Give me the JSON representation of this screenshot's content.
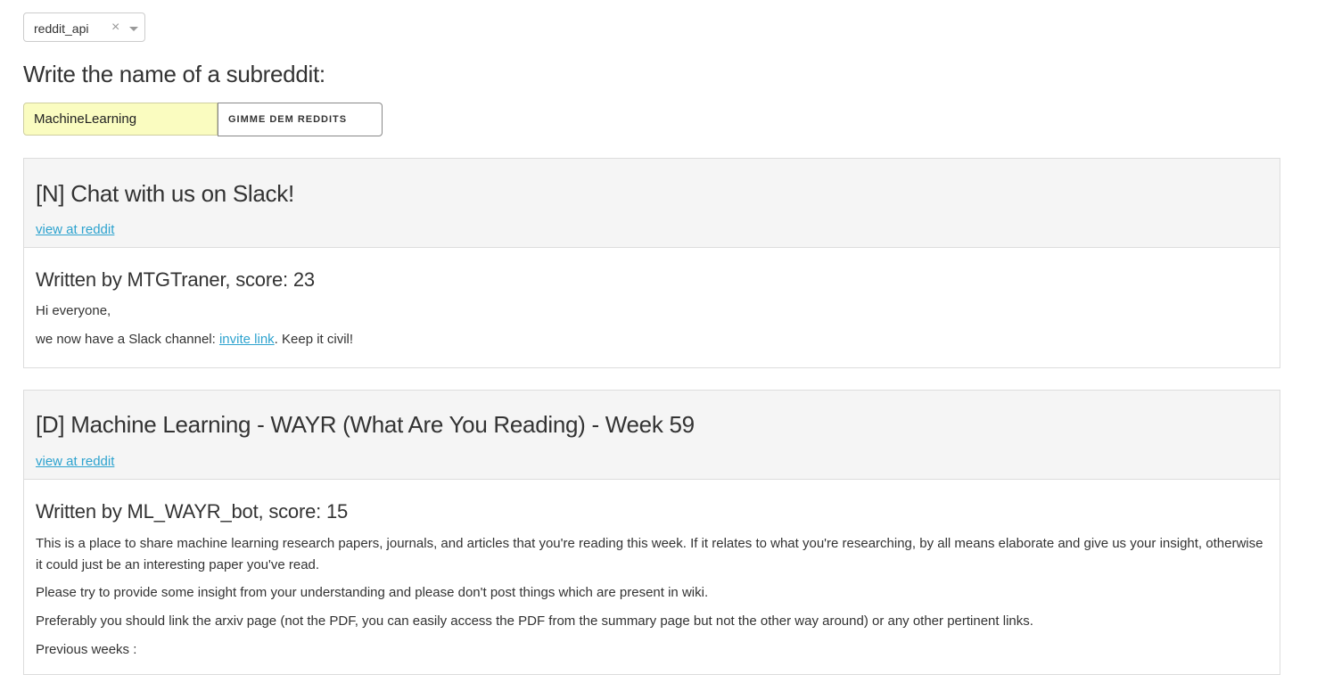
{
  "selector": {
    "value": "reddit_api",
    "clear_glyph": "×"
  },
  "prompt": "Write the name of a subreddit:",
  "search": {
    "value": "MachineLearning",
    "button_label": "GIMME DEM REDDITS"
  },
  "posts": [
    {
      "title": "[N] Chat with us on Slack!",
      "link_label": "view at reddit",
      "author_line": "Written by MTGTraner, score: 23",
      "paragraphs": [
        "Hi everyone,"
      ],
      "p2_before": "we now have a Slack channel: ",
      "p2_link": "invite link",
      "p2_after": ". Keep it civil!"
    },
    {
      "title": "[D] Machine Learning - WAYR (What Are You Reading) - Week 59",
      "link_label": "view at reddit",
      "author_line": "Written by ML_WAYR_bot, score: 15",
      "paragraphs": [
        "This is a place to share machine learning research papers, journals, and articles that you're reading this week. If it relates to what you're researching, by all means elaborate and give us your insight, otherwise it could just be an interesting paper you've read.",
        "Please try to provide some insight from your understanding and please don't post things which are present in wiki.",
        "Preferably you should link the arxiv page (not the PDF, you can easily access the PDF from the summary page but not the other way around) or any other pertinent links.",
        "Previous weeks :"
      ]
    }
  ]
}
